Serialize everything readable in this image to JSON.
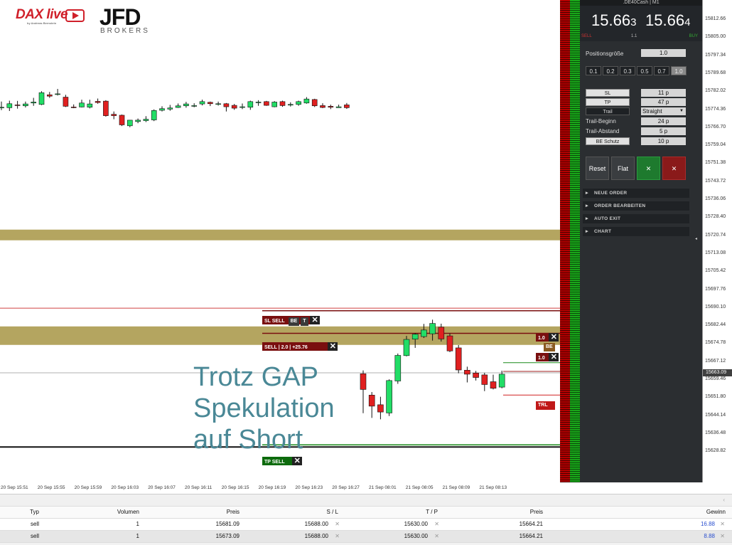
{
  "logos": {
    "dax_live": "DAX live",
    "dax_sub": "by Andreas Bernstein",
    "jfd": "JFD",
    "jfd_sub": "BROKERS"
  },
  "annotation": {
    "lines": [
      "Trotz GAP",
      "Spekulation",
      "auf Short"
    ]
  },
  "chart_tags": {
    "sl_sell": "SL SELL",
    "be": "BE",
    "t": "T",
    "sell_position": "SELL | 2.0 | +25.76",
    "tp_sell": "TP SELL",
    "lot_top": "1.0",
    "lot_bottom": "1.0",
    "be_right": "BE",
    "trl": "TRL"
  },
  "price_axis": {
    "labels": [
      "15812.66",
      "15805.00",
      "15797.34",
      "15789.68",
      "15782.02",
      "15774.36",
      "15766.70",
      "15759.04",
      "15751.38",
      "15743.72",
      "15736.06",
      "15728.40",
      "15720.74",
      "15713.08",
      "15705.42",
      "15697.76",
      "15690.10",
      "15682.44",
      "15674.78",
      "15667.12",
      "15659.46",
      "15651.80",
      "15644.14",
      "15636.48",
      "15628.82"
    ],
    "current": "15663.09"
  },
  "time_axis": {
    "labels": [
      "20 Sep 15:51",
      "20 Sep 15:55",
      "20 Sep 15:59",
      "20 Sep 16:03",
      "20 Sep 16:07",
      "20 Sep 16:11",
      "20 Sep 16:15",
      "20 Sep 16:19",
      "20 Sep 16:23",
      "20 Sep 16:27",
      "21 Sep 08:01",
      "21 Sep 08:05",
      "21 Sep 08:09",
      "21 Sep 08:13"
    ]
  },
  "panel": {
    "header": ".DE40Cash | M1",
    "bid_main": "15.66",
    "bid_small": "3",
    "ask_main": "15.66",
    "ask_small": "4",
    "sell": "SELL",
    "spread": "1.1",
    "buy": "BUY",
    "positionsgroesse_label": "Positionsgröße",
    "positionsgroesse_value": "1.0",
    "lot_buttons": [
      "0.1",
      "0.2",
      "0.3",
      "0.5",
      "0.7",
      "1.0"
    ],
    "sl_label": "SL",
    "sl_value": "11 p",
    "tp_label": "TP",
    "tp_value": "47 p",
    "trail_label": "Trail",
    "trail_value": "Straight",
    "trail_beginn_label": "Trail-Beginn",
    "trail_beginn_value": "24 p",
    "trail_abstand_label": "Trail-Abstand",
    "trail_abstand_value": "5 p",
    "be_schutz_label": "BE Schutz",
    "be_schutz_value": "10 p",
    "reset": "Reset",
    "flat": "Flat",
    "check": "✕",
    "close": "✕",
    "menu": [
      "NEUE ORDER",
      "ORDER BEARBEITEN",
      "AUTO EXIT",
      "CHART"
    ]
  },
  "table": {
    "headers": {
      "typ": "Typ",
      "volumen": "Volumen",
      "preis": "Preis",
      "sl": "S / L",
      "tp": "T / P",
      "preis2": "Preis",
      "gewinn": "Gewinn"
    },
    "rows": [
      {
        "typ": "sell",
        "volumen": "1",
        "preis": "15681.09",
        "sl": "15688.00",
        "tp": "15630.00",
        "preis2": "15664.21",
        "gewinn": "16.88"
      },
      {
        "typ": "sell",
        "volumen": "1",
        "preis": "15673.09",
        "sl": "15688.00",
        "tp": "15630.00",
        "preis2": "15664.21",
        "gewinn": "8.88"
      }
    ]
  },
  "colors": {
    "bull": "#22dd66",
    "bear": "#e02020",
    "zone": "#b4a560",
    "panel_bg": "#2b2e31"
  },
  "chart_data": {
    "type": "candlestick",
    "day1": [
      {
        "o": 15775.2,
        "h": 15777.6,
        "l": 15774.0,
        "c": 15775.2
      },
      {
        "o": 15775.0,
        "h": 15778.0,
        "l": 15773.6,
        "c": 15776.7
      },
      {
        "o": 15776.2,
        "h": 15777.9,
        "l": 15774.6,
        "c": 15776.0
      },
      {
        "o": 15775.8,
        "h": 15777.6,
        "l": 15775.1,
        "c": 15776.6
      },
      {
        "o": 15777.0,
        "h": 15779.2,
        "l": 15775.8,
        "c": 15777.4
      },
      {
        "o": 15776.4,
        "h": 15782.0,
        "l": 15776.1,
        "c": 15781.4
      },
      {
        "o": 15780.5,
        "h": 15781.7,
        "l": 15779.2,
        "c": 15779.9
      },
      {
        "o": 15780.6,
        "h": 15783.0,
        "l": 15780.2,
        "c": 15780.9
      },
      {
        "o": 15779.5,
        "h": 15780.5,
        "l": 15775.3,
        "c": 15775.6
      },
      {
        "o": 15775.3,
        "h": 15776.4,
        "l": 15774.8,
        "c": 15775.1
      },
      {
        "o": 15775.3,
        "h": 15778.4,
        "l": 15775.1,
        "c": 15777.0
      },
      {
        "o": 15775.2,
        "h": 15778.4,
        "l": 15774.7,
        "c": 15776.6
      },
      {
        "o": 15777.7,
        "h": 15778.9,
        "l": 15776.7,
        "c": 15777.2
      },
      {
        "o": 15777.8,
        "h": 15778.2,
        "l": 15771.2,
        "c": 15771.6
      },
      {
        "o": 15772.2,
        "h": 15773.4,
        "l": 15770.1,
        "c": 15771.6
      },
      {
        "o": 15771.8,
        "h": 15772.1,
        "l": 15767.2,
        "c": 15767.7
      },
      {
        "o": 15767.3,
        "h": 15769.8,
        "l": 15766.7,
        "c": 15769.7
      },
      {
        "o": 15769.1,
        "h": 15770.4,
        "l": 15768.4,
        "c": 15769.7
      },
      {
        "o": 15769.5,
        "h": 15771.4,
        "l": 15768.9,
        "c": 15770.1
      },
      {
        "o": 15769.8,
        "h": 15774.3,
        "l": 15769.3,
        "c": 15773.8
      },
      {
        "o": 15773.9,
        "h": 15775.6,
        "l": 15773.4,
        "c": 15774.6
      },
      {
        "o": 15774.4,
        "h": 15776.2,
        "l": 15773.7,
        "c": 15774.9
      },
      {
        "o": 15775.1,
        "h": 15776.8,
        "l": 15774.9,
        "c": 15775.8
      },
      {
        "o": 15775.8,
        "h": 15777.5,
        "l": 15775.0,
        "c": 15776.6
      },
      {
        "o": 15775.9,
        "h": 15776.9,
        "l": 15775.2,
        "c": 15775.9
      },
      {
        "o": 15776.6,
        "h": 15778.4,
        "l": 15776.0,
        "c": 15777.6
      },
      {
        "o": 15777.3,
        "h": 15777.6,
        "l": 15775.7,
        "c": 15776.7
      },
      {
        "o": 15776.7,
        "h": 15777.6,
        "l": 15775.9,
        "c": 15776.7
      },
      {
        "o": 15776.7,
        "h": 15777.0,
        "l": 15773.4,
        "c": 15775.4
      },
      {
        "o": 15776.0,
        "h": 15776.6,
        "l": 15774.1,
        "c": 15774.8
      },
      {
        "o": 15775.1,
        "h": 15776.8,
        "l": 15774.4,
        "c": 15775.4
      },
      {
        "o": 15775.2,
        "h": 15778.0,
        "l": 15774.1,
        "c": 15777.6
      },
      {
        "o": 15777.2,
        "h": 15778.2,
        "l": 15775.8,
        "c": 15777.4
      },
      {
        "o": 15777.6,
        "h": 15777.9,
        "l": 15775.8,
        "c": 15776.0
      },
      {
        "o": 15775.4,
        "h": 15777.8,
        "l": 15775.2,
        "c": 15777.4
      },
      {
        "o": 15777.6,
        "h": 15778.0,
        "l": 15775.4,
        "c": 15775.9
      },
      {
        "o": 15776.1,
        "h": 15777.3,
        "l": 15775.5,
        "c": 15776.4
      },
      {
        "o": 15776.4,
        "h": 15778.0,
        "l": 15775.8,
        "c": 15777.6
      },
      {
        "o": 15777.0,
        "h": 15779.5,
        "l": 15776.7,
        "c": 15778.7
      },
      {
        "o": 15778.5,
        "h": 15778.8,
        "l": 15775.3,
        "c": 15775.8
      },
      {
        "o": 15775.9,
        "h": 15776.9,
        "l": 15774.8,
        "c": 15775.1
      },
      {
        "o": 15775.6,
        "h": 15776.3,
        "l": 15774.4,
        "c": 15775.2
      },
      {
        "o": 15775.0,
        "h": 15776.3,
        "l": 15775.0,
        "c": 15775.4
      },
      {
        "o": 15776.2,
        "h": 15777.0,
        "l": 15774.5,
        "c": 15775.0
      }
    ],
    "day2": [
      {
        "o": 15661.8,
        "h": 15663.2,
        "l": 15645.0,
        "c": 15655.1
      },
      {
        "o": 15652.7,
        "h": 15654.0,
        "l": 15643.0,
        "c": 15648.0
      },
      {
        "o": 15648.6,
        "h": 15652.0,
        "l": 15642.4,
        "c": 15645.5
      },
      {
        "o": 15645.1,
        "h": 15659.4,
        "l": 15643.8,
        "c": 15658.9
      },
      {
        "o": 15658.7,
        "h": 15670.4,
        "l": 15657.5,
        "c": 15669.6
      },
      {
        "o": 15669.5,
        "h": 15677.9,
        "l": 15669.2,
        "c": 15676.4
      },
      {
        "o": 15676.5,
        "h": 15679.1,
        "l": 15672.8,
        "c": 15678.6
      },
      {
        "o": 15677.6,
        "h": 15683.0,
        "l": 15677.0,
        "c": 15680.4
      },
      {
        "o": 15678.8,
        "h": 15684.8,
        "l": 15675.9,
        "c": 15683.2
      },
      {
        "o": 15681.6,
        "h": 15683.1,
        "l": 15675.5,
        "c": 15676.6
      },
      {
        "o": 15677.9,
        "h": 15678.9,
        "l": 15671.0,
        "c": 15671.5
      },
      {
        "o": 15672.8,
        "h": 15674.0,
        "l": 15662.0,
        "c": 15663.4
      },
      {
        "o": 15663.3,
        "h": 15664.8,
        "l": 15658.1,
        "c": 15661.6
      },
      {
        "o": 15662.1,
        "h": 15663.0,
        "l": 15658.9,
        "c": 15660.2
      },
      {
        "o": 15661.3,
        "h": 15662.2,
        "l": 15654.4,
        "c": 15657.2
      },
      {
        "o": 15658.4,
        "h": 15661.4,
        "l": 15655.1,
        "c": 15655.6
      },
      {
        "o": 15656.1,
        "h": 15663.1,
        "l": 15655.6,
        "c": 15661.6
      }
    ],
    "levels": {
      "zone_upper": 15720.7,
      "zone_lower": 15678.0,
      "sl": 15688.0,
      "tp": 15630.0,
      "entry": 15681.1,
      "current": 15663.09
    }
  }
}
